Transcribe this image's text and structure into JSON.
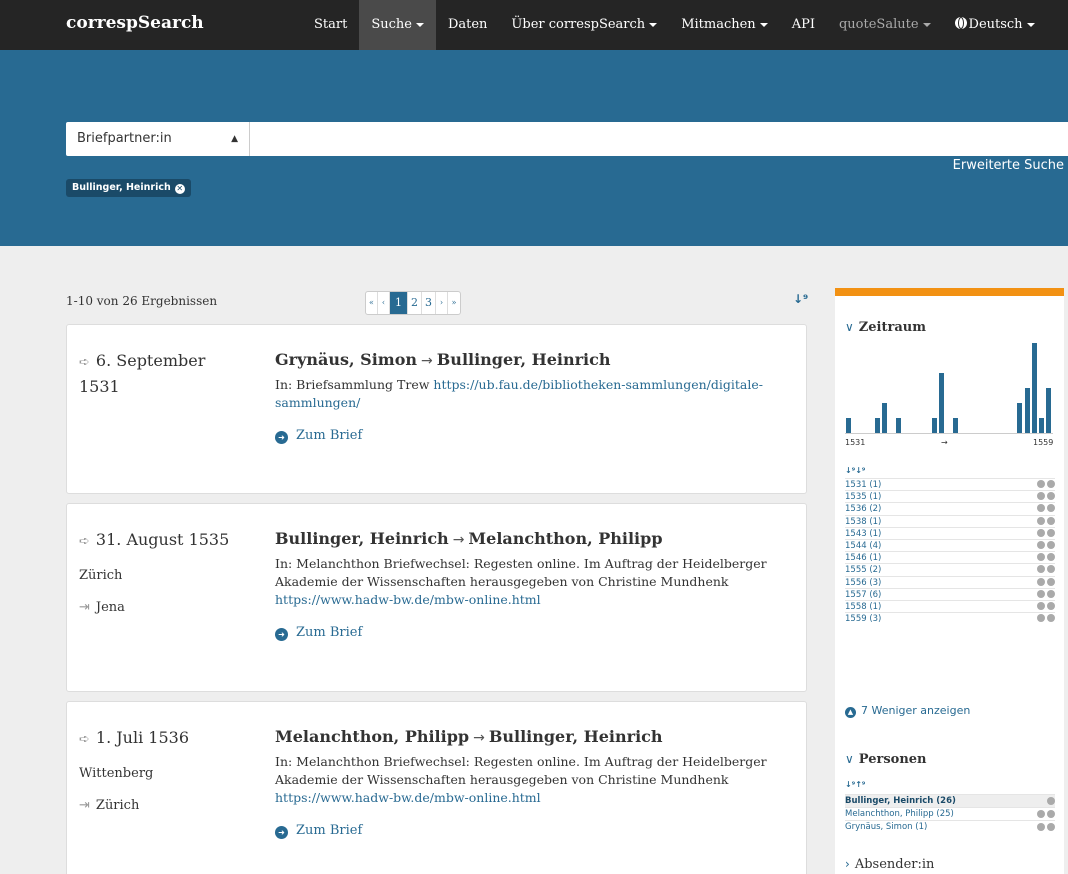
{
  "nav": {
    "brand": "correspSearch",
    "items": [
      {
        "label": "Start"
      },
      {
        "label": "Suche"
      },
      {
        "label": "Daten"
      },
      {
        "label": "Über correspSearch"
      },
      {
        "label": "Mitmachen"
      },
      {
        "label": "API"
      },
      {
        "label": "quoteSalute"
      },
      {
        "label": "Deutsch"
      }
    ]
  },
  "search": {
    "field_select": "Briefpartner:in",
    "advanced_link": "Erweiterte Suche",
    "active_filter": "Bullinger, Heinrich"
  },
  "results": {
    "count_text": "1-10 von 26 Ergebnissen",
    "pages": [
      "«",
      "‹",
      "1",
      "2",
      "3",
      "›",
      "»"
    ],
    "current_page": "1",
    "cards": [
      {
        "date": "6. September 1531",
        "from_place": "",
        "to_place": "",
        "sender": "Grynäus, Simon",
        "receiver": "Bullinger, Heinrich",
        "desc_prefix": "In: Briefsammlung Trew ",
        "desc_link": "https://ub.fau.de/bibliotheken-sammlungen/digitale-sammlungen/",
        "action": "Zum Brief"
      },
      {
        "date": "31. August 1535",
        "from_place": "Zürich",
        "to_place": "Jena",
        "sender": "Bullinger, Heinrich",
        "receiver": "Melanchthon, Philipp",
        "desc_prefix": "In: Melanchthon Briefwechsel: Regesten online. Im Auftrag der Heidelberger Akademie der Wissenschaften herausgegeben von Christine Mundhenk ",
        "desc_link": "https://www.hadw-bw.de/mbw-online.html",
        "action": "Zum Brief"
      },
      {
        "date": "1. Juli 1536",
        "from_place": "Wittenberg",
        "to_place": "Zürich",
        "sender": "Melanchthon, Philipp",
        "receiver": "Bullinger, Heinrich",
        "desc_prefix": "In: Melanchthon Briefwechsel: Regesten online. Im Auftrag der Heidelberger Akademie der Wissenschaften herausgegeben von Christine Mundhenk ",
        "desc_link": "https://www.hadw-bw.de/mbw-online.html",
        "action": "Zum Brief"
      }
    ]
  },
  "sidebar": {
    "zeitraum_title": "Zeitraum",
    "hist_start": "1531",
    "hist_mid": "→",
    "hist_end": "1559",
    "histogram": [
      {
        "year": 1531,
        "count": 1
      },
      {
        "year": 1535,
        "count": 1
      },
      {
        "year": 1536,
        "count": 2
      },
      {
        "year": 1538,
        "count": 1
      },
      {
        "year": 1543,
        "count": 1
      },
      {
        "year": 1544,
        "count": 4
      },
      {
        "year": 1546,
        "count": 1
      },
      {
        "year": 1555,
        "count": 2
      },
      {
        "year": 1556,
        "count": 3
      },
      {
        "year": 1557,
        "count": 6
      },
      {
        "year": 1558,
        "count": 1
      },
      {
        "year": 1559,
        "count": 3
      }
    ],
    "years": [
      "1531 (1)",
      "1535 (1)",
      "1536 (2)",
      "1538 (1)",
      "1543 (1)",
      "1544 (4)",
      "1546 (1)",
      "1555 (2)",
      "1556 (3)",
      "1557 (6)",
      "1558 (1)",
      "1559 (3)"
    ],
    "less_link": "7 Weniger anzeigen",
    "personen_title": "Personen",
    "persons": [
      "Bullinger, Heinrich (26)",
      "Melanchthon, Philipp (25)",
      "Grynäus, Simon (1)"
    ],
    "absender_title": "Absender:in",
    "accent": "#f29113"
  },
  "colors": {
    "navbar": "#252525",
    "band": "#286a92",
    "link": "#286a92"
  }
}
